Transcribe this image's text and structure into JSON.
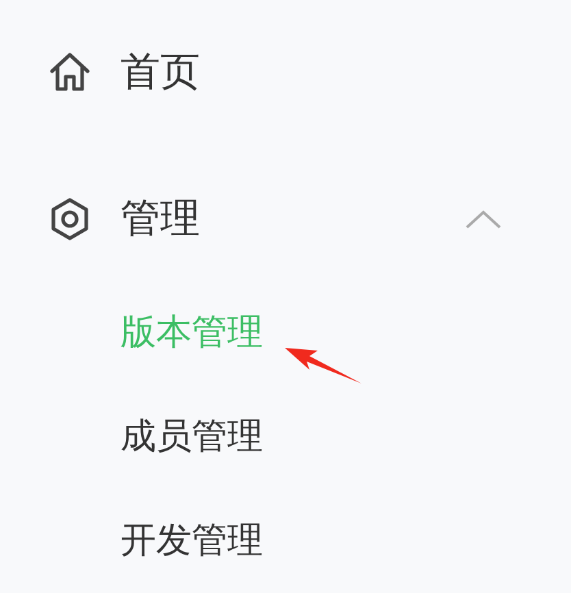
{
  "menu": [
    {
      "label": "首页",
      "kind": "link"
    },
    {
      "label": "管理",
      "kind": "group",
      "expanded": true,
      "children": [
        {
          "label": "版本管理",
          "selected": true
        },
        {
          "label": "成员管理",
          "selected": false
        },
        {
          "label": "开发管理",
          "selected": false
        }
      ]
    }
  ]
}
